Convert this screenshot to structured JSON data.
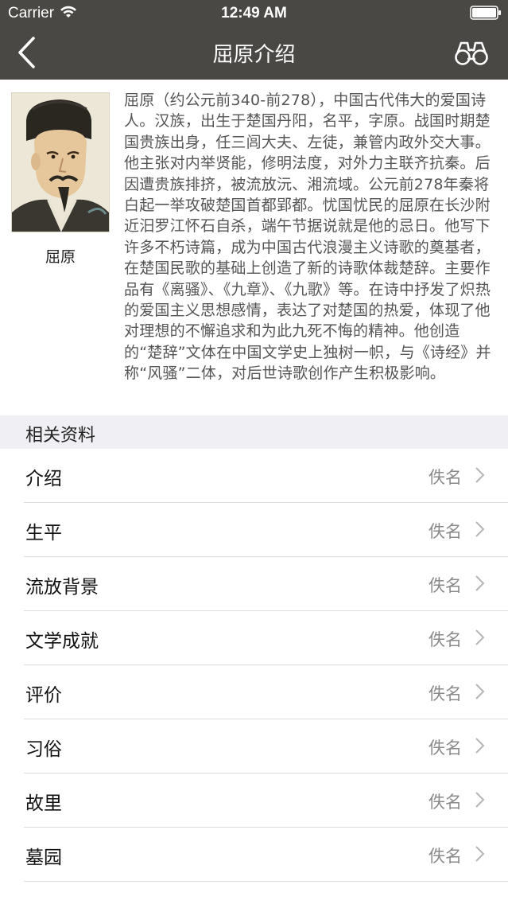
{
  "status_bar": {
    "carrier": "Carrier",
    "time": "12:49 AM",
    "icons": [
      "wifi-icon",
      "battery-icon"
    ]
  },
  "nav": {
    "title": "屈原介绍",
    "back_icon": "chevron-left-icon",
    "action_icon": "binoculars-icon",
    "background": "#4a4845"
  },
  "intro": {
    "portrait_caption": "屈原",
    "text": "屈原（约公元前340-前278），中国古代伟大的爱国诗人。汉族，出生于楚国丹阳，名平，字原。战国时期楚国贵族出身，任三闾大夫、左徒，兼管内政外交大事。他主张对内举贤能，修明法度，对外力主联齐抗秦。后因遭贵族排挤，被流放沅、湘流域。公元前278年秦将白起一举攻破楚国首都郢都。忧国忧民的屈原在长沙附近汨罗江怀石自杀，端午节据说就是他的忌日。他写下许多不朽诗篇，成为中国古代浪漫主义诗歌的奠基者，在楚国民歌的基础上创造了新的诗歌体裁楚辞。主要作品有《离骚》、《九章》、《九歌》等。在诗中抒发了炽热的爱国主义思想感情，表达了对楚国的热爱，体现了他对理想的不懈追求和为此九死不悔的精神。他创造的“楚辞”文体在中国文学史上独树一帜，与《诗经》并称“风骚”二体，对后世诗歌创作产生积极影响。"
  },
  "related": {
    "header": "相关资料",
    "items": [
      {
        "label": "介绍",
        "value": "佚名"
      },
      {
        "label": "生平",
        "value": "佚名"
      },
      {
        "label": "流放背景",
        "value": "佚名"
      },
      {
        "label": "文学成就",
        "value": "佚名"
      },
      {
        "label": "评价",
        "value": "佚名"
      },
      {
        "label": "习俗",
        "value": "佚名"
      },
      {
        "label": "故里",
        "value": "佚名"
      },
      {
        "label": "墓园",
        "value": "佚名"
      }
    ]
  }
}
